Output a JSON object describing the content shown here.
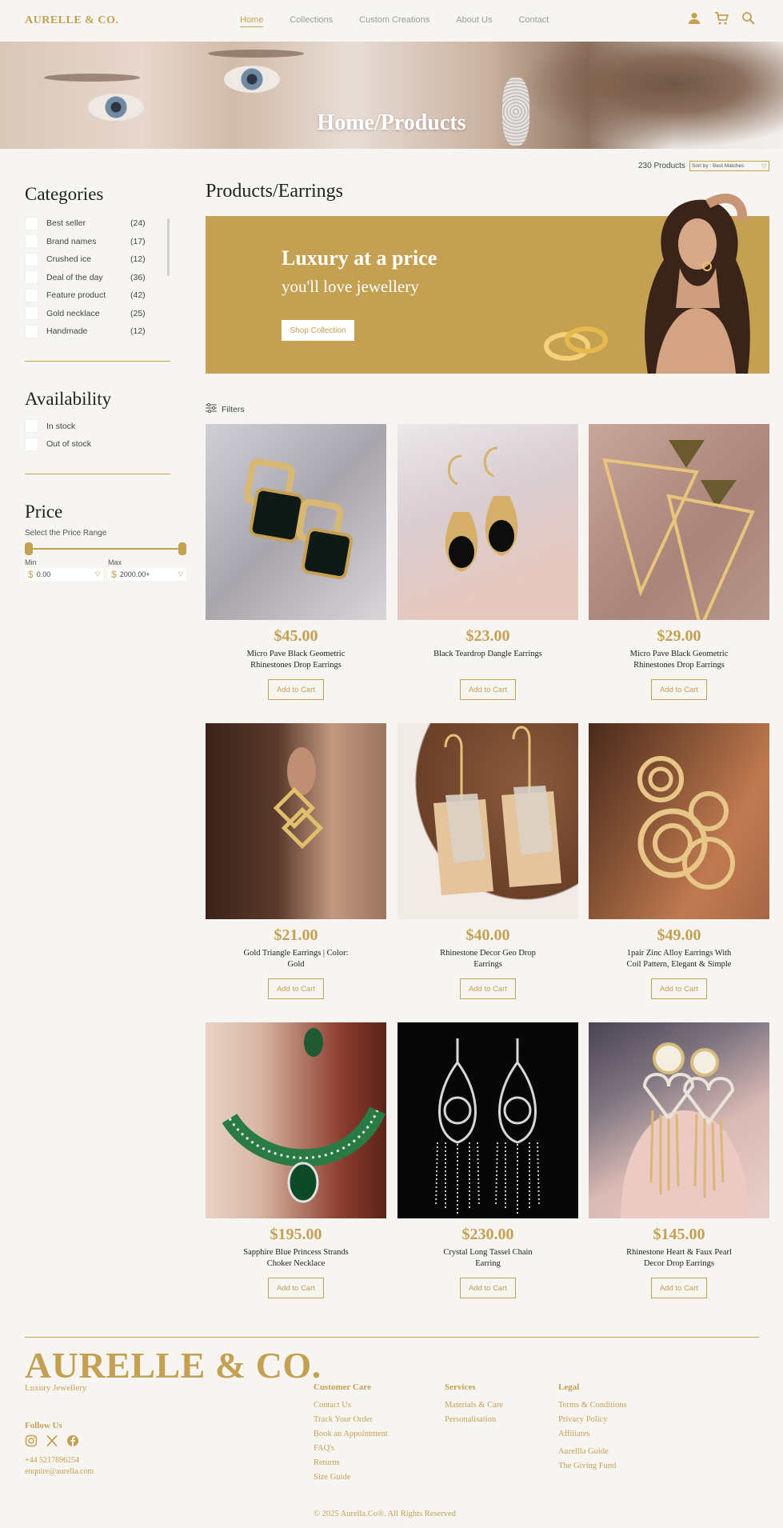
{
  "header": {
    "logo": "AURELLE & CO.",
    "nav": [
      "Home",
      "Collections",
      "Custom Creations",
      "About Us",
      "Contact"
    ],
    "active_nav": "Home",
    "icons": [
      "user-icon",
      "cart-icon",
      "search-icon"
    ]
  },
  "hero": {
    "title": "Home/Products"
  },
  "toolbar": {
    "count": "230 Products",
    "sort": "Sort by : Best Matches"
  },
  "sidebar": {
    "categories_title": "Categories",
    "categories": [
      {
        "label": "Best seller",
        "count": "(24)"
      },
      {
        "label": "Brand names",
        "count": "(17)"
      },
      {
        "label": "Crushed ice",
        "count": "(12)"
      },
      {
        "label": "Deal of the day",
        "count": "(36)"
      },
      {
        "label": "Feature product",
        "count": "(42)"
      },
      {
        "label": "Gold necklace",
        "count": "(25)"
      },
      {
        "label": "Handmade",
        "count": "(12)"
      }
    ],
    "availability_title": "Availability",
    "availability": [
      "In stock",
      "Out of stock"
    ],
    "price_title": "Price",
    "price_subtitle": "Select the Price Range",
    "min_label": "Min",
    "max_label": "Max",
    "min_value": "0.00",
    "max_value": "2000.00+",
    "currency": "$"
  },
  "section_title": "Products/Earrings",
  "banner": {
    "headline": "Luxury at a price",
    "subline": "you'll love jewellery",
    "button": "Shop Collection"
  },
  "filters_label": "Filters",
  "products": [
    {
      "price": "$45.00",
      "name": "Micro Pave Black Geometric Rhinestones Drop Earrings",
      "button": "Add to Cart"
    },
    {
      "price": "$23.00",
      "name": "Black Teardrop Dangle Earrings",
      "button": "Add to Cart"
    },
    {
      "price": "$29.00",
      "name": "Micro Pave Black Geometric Rhinestones Drop Earrings",
      "button": "Add to Cart"
    },
    {
      "price": "$21.00",
      "name": "Gold Triangle Earrings | Color: Gold",
      "button": "Add to Cart"
    },
    {
      "price": "$40.00",
      "name": "Rhinestone Decor Geo Drop Earrings",
      "button": "Add to Cart"
    },
    {
      "price": "$49.00",
      "name": "1pair Zinc Alloy Earrings With Coil Pattern, Elegant & Simple",
      "button": "Add to Cart"
    },
    {
      "price": "$195.00",
      "name": "Sapphire Blue Princess Strands Choker Necklace",
      "button": "Add to Cart"
    },
    {
      "price": "$230.00",
      "name": "Crystal Long Tassel Chain Earring",
      "button": "Add to Cart"
    },
    {
      "price": "$145.00",
      "name": "Rhinestone Heart & Faux Pearl Decor Drop Earrings",
      "button": "Add to Cart"
    }
  ],
  "footer": {
    "logo": "AURELLE & CO.",
    "tagline": "Luxury Jewellery",
    "follow": "Follow Us",
    "phone": "+44 5217896254",
    "email": "enquire@aurella.com",
    "columns": [
      {
        "title": "Customer Care",
        "links": [
          "Contact Us",
          "Track Your Order",
          "Book an Appointment",
          "FAQ's",
          "Returns",
          "Size Guide"
        ]
      },
      {
        "title": "Services",
        "links": [
          "Materials & Care",
          "Personalisation"
        ]
      },
      {
        "title": "Legal",
        "links": [
          "Terms & Conditions",
          "Privacy Policy",
          "Affiliates",
          "Aurellla Guide",
          "The Giving Fund"
        ]
      }
    ],
    "copyright": "© 2025 Aurella.Co®. All Rights Reserved"
  },
  "colors": {
    "accent": "#c4a052",
    "background": "#f7f5f1"
  }
}
